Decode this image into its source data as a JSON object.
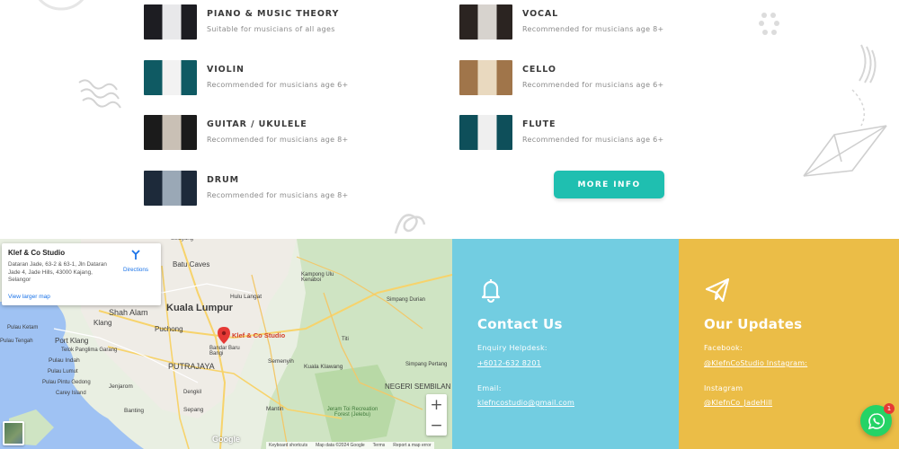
{
  "courses": [
    {
      "title": "PIANO & MUSIC THEORY",
      "subtitle": "Suitable for musicians of all ages",
      "thumb_colors": [
        "#1d1d22",
        "#e8e8ea"
      ]
    },
    {
      "title": "VOCAL",
      "subtitle": "Recommended for musicians age 8+",
      "thumb_colors": [
        "#2b2421",
        "#d7d3ce"
      ]
    },
    {
      "title": "VIOLIN",
      "subtitle": "Recommended for musicians age 6+",
      "thumb_colors": [
        "#0f5a63",
        "#f2f2f2"
      ]
    },
    {
      "title": "CELLO",
      "subtitle": "Recommended for musicians age 6+",
      "thumb_colors": [
        "#a0754a",
        "#e9d9bf"
      ]
    },
    {
      "title": "GUITAR / UKULELE",
      "subtitle": "Recommended for musicians age 8+",
      "thumb_colors": [
        "#1b1b1b",
        "#c9c0b5"
      ]
    },
    {
      "title": "FLUTE",
      "subtitle": "Recommended for musicians age 6+",
      "thumb_colors": [
        "#0e4f5a",
        "#efefef"
      ]
    },
    {
      "title": "DRUM",
      "subtitle": "Recommended for musicians age 8+",
      "thumb_colors": [
        "#1d2a3a",
        "#9aa8b6"
      ]
    }
  ],
  "more_info_label": "MORE INFO",
  "map": {
    "place_name": "Klef & Co Studio",
    "address": "Dataran Jade, 63-2 & 63-1, Jln Dataran Jade 4, Jade Hills, 43000 Kajang, Selangor",
    "directions_label": "Directions",
    "larger_map_label": "View larger map",
    "pin_label": "Klef & Co Studio",
    "zoom_in": "+",
    "zoom_out": "−",
    "google_label": "Google",
    "attribution": [
      "Keyboard shortcuts",
      "Map data ©2024 Google",
      "Terms",
      "Report a map error"
    ],
    "labels": [
      {
        "text": "Batu Caves"
      },
      {
        "text": "Selayang"
      },
      {
        "text": "Kuala Lumpur"
      },
      {
        "text": "Hulu Langat"
      },
      {
        "text": "Kampong Ulu Kenaboi"
      },
      {
        "text": "Shah Alam"
      },
      {
        "text": "Klang"
      },
      {
        "text": "Puchong"
      },
      {
        "text": "Port Klang"
      },
      {
        "text": "Pulau Ketam"
      },
      {
        "text": "Pulau Tengah"
      },
      {
        "text": "PUTRAJAYA"
      },
      {
        "text": "Semenyih"
      },
      {
        "text": "Bandar Baru Bangi"
      },
      {
        "text": "Jenjarom"
      },
      {
        "text": "Dengkil"
      },
      {
        "text": "Pulau Indah"
      },
      {
        "text": "Carey Island"
      },
      {
        "text": "Banting"
      },
      {
        "text": "Sepang"
      },
      {
        "text": "Mantin"
      },
      {
        "text": "Kuala Klawang"
      },
      {
        "text": "Simpang Durian"
      },
      {
        "text": "Simpang Pertang"
      },
      {
        "text": "Titi"
      },
      {
        "text": "NEGERI SEMBILAN"
      },
      {
        "text": "Jeram Toi Recreation Forest (Jelebu)"
      },
      {
        "text": "Pulau Lumut"
      },
      {
        "text": "Pulau Pintu Gedong"
      },
      {
        "text": "Telok Panglima Garang"
      }
    ]
  },
  "contact": {
    "title": "Contact Us",
    "enquiry_label": "Enquiry Helpdesk:",
    "phone": "+6012-632 8201",
    "email_label": "Email:",
    "email": "klefncostudio@gmail.com",
    "bg_color": "#72cde1"
  },
  "updates": {
    "title": "Our Updates",
    "facebook_label": "Facebook:",
    "facebook_link": "@KlefnCoStudio Instagram:",
    "instagram_label": "Instagram",
    "instagram_link": "@KlefnCo_JadeHill",
    "bg_color": "#ebbd47"
  },
  "whatsapp": {
    "badge": "1",
    "color": "#25d366"
  },
  "accent_color": "#1fbfb0"
}
